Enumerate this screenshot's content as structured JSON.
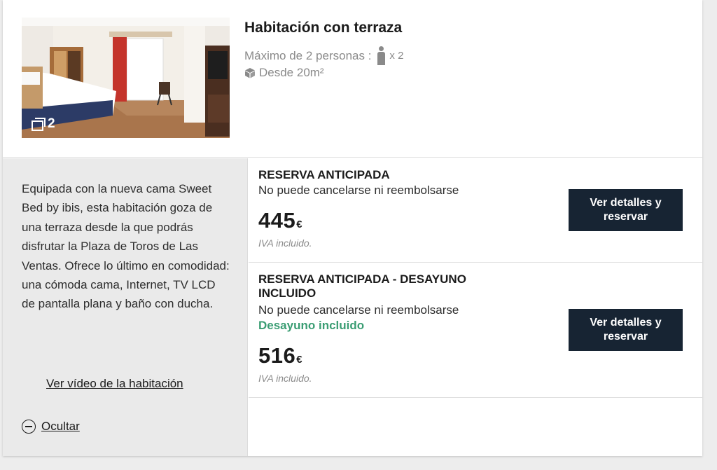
{
  "room": {
    "title": "Habitación con terraza",
    "occupancy_label": "Máximo de 2 personas :",
    "occupancy_multiplier": "x 2",
    "size": "Desde 20m²",
    "photo_count": "2",
    "description": "Equipada con la nueva cama Sweet Bed by ibis, esta habitación goza de una terraza desde la que podrás disfrutar la Plaza de Toros de Las Ventas. Ofrece lo último en comodidad: una cómoda cama, Internet, TV LCD de pantalla plana y baño con ducha.",
    "video_link": "Ver vídeo de la habitación",
    "hide_link": "Ocultar"
  },
  "rates": [
    {
      "name": "RESERVA ANTICIPADA",
      "condition": "No puede cancelarse ni reembolsarse",
      "extra": "",
      "price": "445",
      "currency": "€",
      "tax_note": "IVA incluido.",
      "button": "Ver detalles y reservar"
    },
    {
      "name": "RESERVA ANTICIPADA - DESAYUNO INCLUIDO",
      "condition": "No puede cancelarse ni reembolsarse",
      "extra": "Desayuno incluido",
      "price": "516",
      "currency": "€",
      "tax_note": "IVA incluido.",
      "button": "Ver detalles y reservar"
    }
  ],
  "icons": {
    "gallery": "gallery-icon",
    "person": "person-icon",
    "size": "cube-icon",
    "hide": "minus-circle-icon"
  },
  "colors": {
    "button_bg": "#172433",
    "extra_green": "#3a9d73",
    "panel_bg": "#eaeaea"
  }
}
